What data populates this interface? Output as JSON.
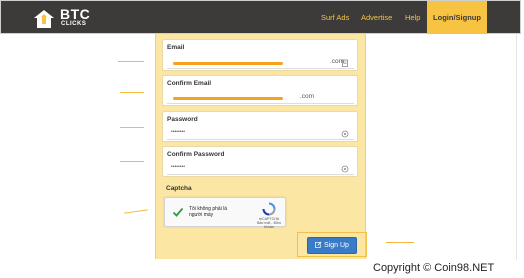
{
  "brand": {
    "title": "BTC",
    "subtitle": "CLICKS"
  },
  "nav": {
    "items": [
      {
        "label": "Surf Ads"
      },
      {
        "label": "Advertise"
      },
      {
        "label": "Help"
      },
      {
        "label": "Login/Signup"
      }
    ]
  },
  "form": {
    "email": {
      "label": "Email",
      "value_suffix": ".com"
    },
    "confirm_email": {
      "label": "Confirm Email",
      "value_suffix": ".com"
    },
    "password": {
      "label": "Password",
      "value": "••••••••"
    },
    "confirm_password": {
      "label": "Confirm Password",
      "value": "••••••••"
    },
    "captcha": {
      "label": "Captcha",
      "checkbox_text": "Tôi không phải là người máy",
      "provider": "reCAPTCHA",
      "terms": "Bảo mật - Điều khoản"
    },
    "signup_label": "Sign Up"
  },
  "watermark": "Copyright © Coin98.NET",
  "colors": {
    "topbar": "#3d3a3a",
    "accent": "#f6c343",
    "form_background": "#fbe6a4",
    "button": "#3a7bc8",
    "annotation_arrow": "#f6b93b"
  }
}
